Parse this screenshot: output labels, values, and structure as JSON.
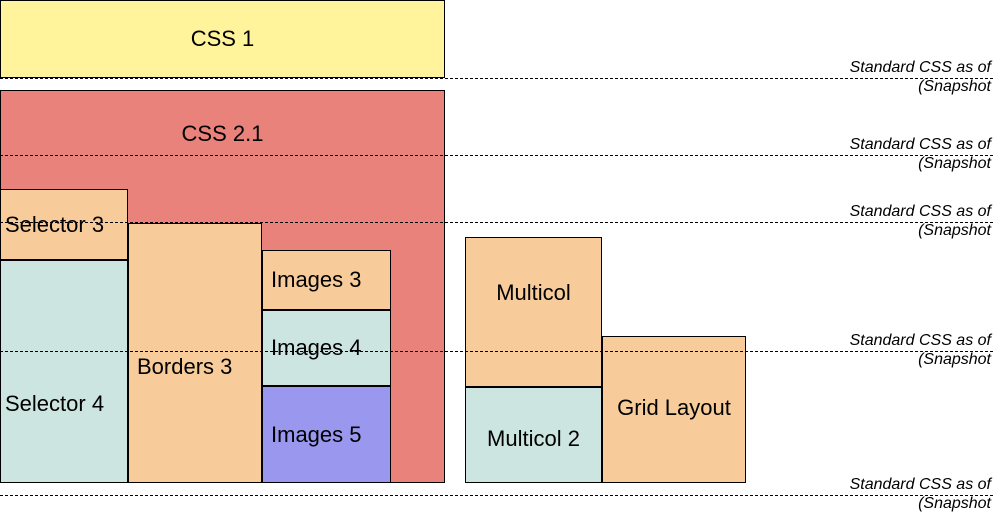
{
  "blocks": {
    "css1": "CSS 1",
    "css21": "CSS 2.1",
    "selector3": "Selector 3",
    "selector4": "Selector 4",
    "borders3": "Borders 3",
    "images3": "Images 3",
    "images4": "Images 4",
    "images5": "Images 5",
    "multicol": "Multicol",
    "multicol2": "Multicol 2",
    "gridlayout": "Grid Layout"
  },
  "annotations": {
    "a1": {
      "line1": "Standard CSS as of",
      "line2": "(Snapshot"
    },
    "a2": {
      "line1": "Standard CSS as of",
      "line2": "(Snapshot"
    },
    "a3": {
      "line1": "Standard CSS as of",
      "line2": "(Snapshot"
    },
    "a4": {
      "line1": "Standard CSS as of",
      "line2": "(Snapshot"
    },
    "a5": {
      "line1": "Standard CSS as of",
      "line2": "(Snapshot"
    }
  }
}
